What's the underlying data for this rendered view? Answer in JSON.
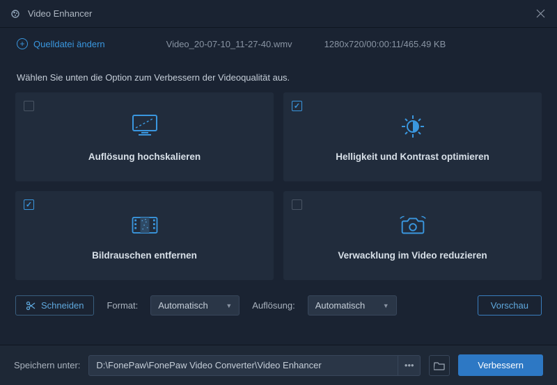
{
  "titlebar": {
    "title": "Video Enhancer"
  },
  "source": {
    "change_label": "Quelldatei ändern",
    "filename": "Video_20-07-10_11-27-40.wmv",
    "meta": "1280x720/00:00:11/465.49 KB"
  },
  "instruction": "Wählen Sie unten die Option zum Verbessern der Videoqualität aus.",
  "cards": [
    {
      "id": "upscale",
      "label": "Auflösung hochskalieren",
      "checked": false
    },
    {
      "id": "brightness",
      "label": "Helligkeit und Kontrast optimieren",
      "checked": true
    },
    {
      "id": "denoise",
      "label": "Bildrauschen entfernen",
      "checked": true
    },
    {
      "id": "deshake",
      "label": "Verwacklung im Video reduzieren",
      "checked": false
    }
  ],
  "controls": {
    "cut_label": "Schneiden",
    "format_label": "Format:",
    "format_value": "Automatisch",
    "resolution_label": "Auflösung:",
    "resolution_value": "Automatisch",
    "preview_label": "Vorschau"
  },
  "footer": {
    "save_label": "Speichern unter:",
    "path": "D:\\FonePaw\\FonePaw Video Converter\\Video Enhancer",
    "enhance_label": "Verbessern"
  },
  "colors": {
    "accent": "#3a97df",
    "primary_btn": "#2d78c4"
  }
}
